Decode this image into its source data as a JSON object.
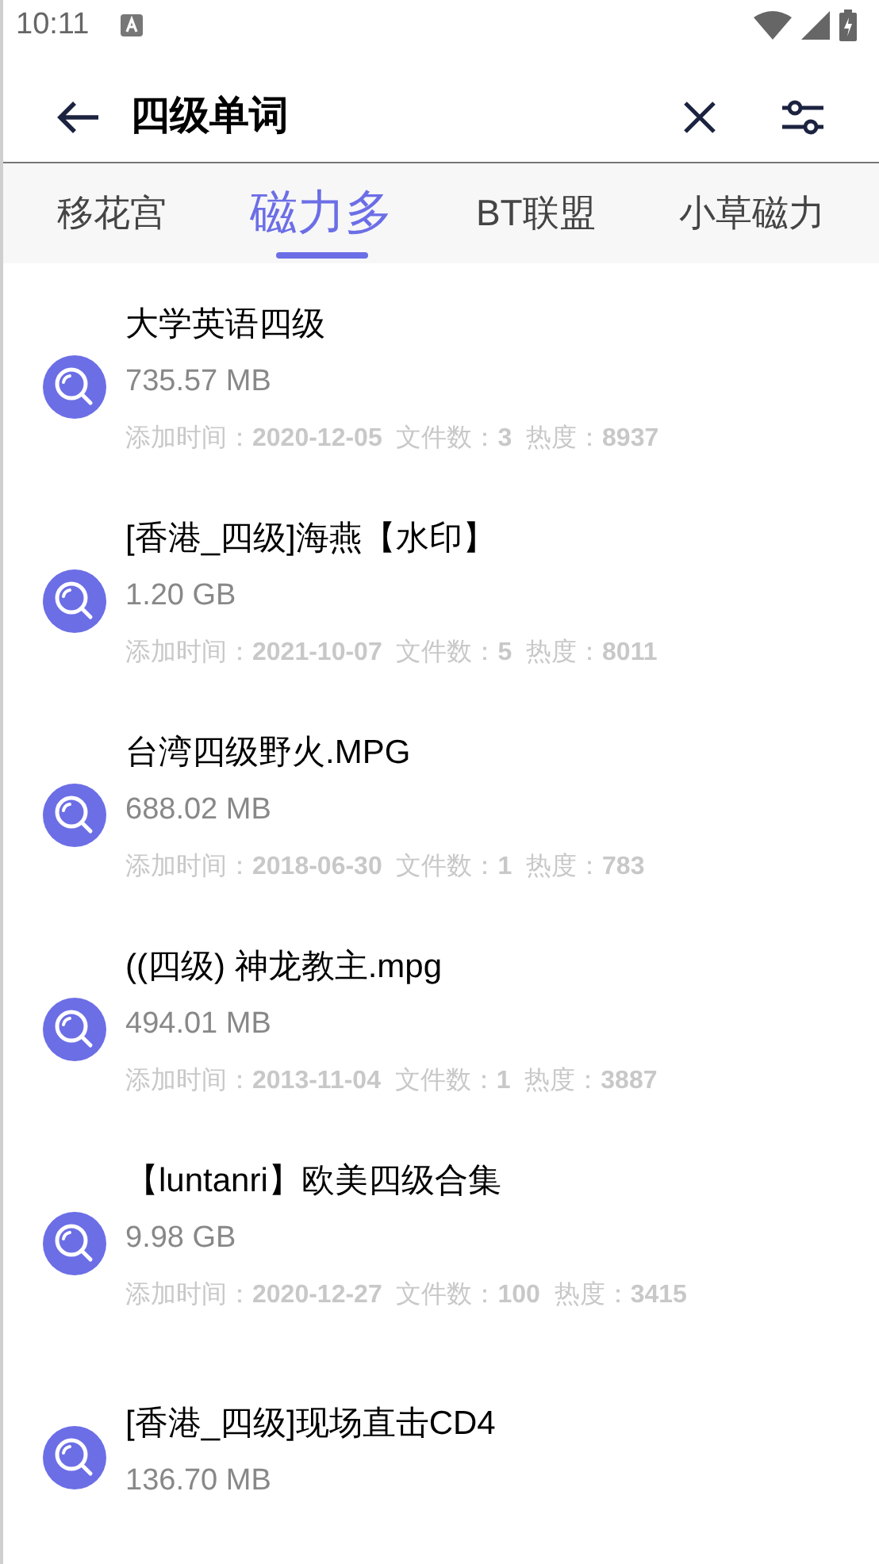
{
  "status_bar": {
    "time": "10:11"
  },
  "toolbar": {
    "query": "四级单词"
  },
  "tabs": [
    {
      "label": "移花宫",
      "selected": false
    },
    {
      "label": "磁力多",
      "selected": true
    },
    {
      "label": "BT联盟",
      "selected": false
    },
    {
      "label": "小草磁力",
      "selected": false
    }
  ],
  "results": [
    {
      "title": "大学英语四级",
      "size": "735.57 MB",
      "meta": "添加时间：**2020-12-05**  文件数：**3**  热度：**8937**"
    },
    {
      "title": "[香港_四级]海燕【水印】",
      "size": "1.20 GB",
      "meta": "添加时间：**2021-10-07**  文件数：**5**  热度：**8011**"
    },
    {
      "title": "台湾四级野火.MPG",
      "size": "688.02 MB",
      "meta": "添加时间：**2018-06-30**  文件数：**1**  热度：**783**"
    },
    {
      "title": "((四级) 神龙教主.mpg",
      "size": "494.01 MB",
      "meta": "添加时间：**2013-11-04**  文件数：**1**  热度：**3887**"
    },
    {
      "title": "【luntanri】欧美四级合集",
      "size": "9.98 GB",
      "meta": "添加时间：**2020-12-27**  文件数：**100**  热度：**3415**"
    },
    {
      "title": "[香港_四级]现场直击CD4",
      "size": "136.70 MB"
    }
  ]
}
